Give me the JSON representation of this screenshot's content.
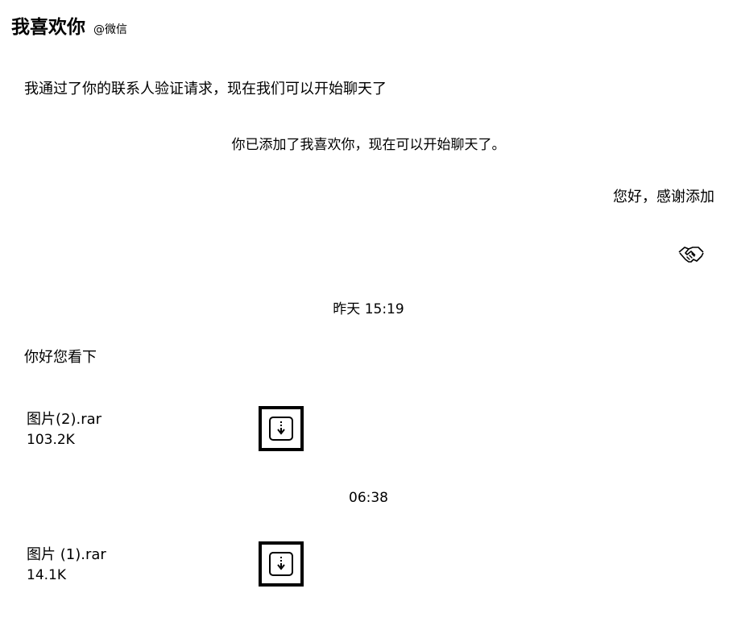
{
  "header": {
    "contact_name": "我喜欢你",
    "platform": "@微信"
  },
  "messages": {
    "incoming_verify": "我通过了你的联系人验证请求，现在我们可以开始聊天了",
    "system_added": "你已添加了我喜欢你，现在可以开始聊天了。",
    "outgoing_thanks": "您好，感谢添加",
    "outgoing_emoji": "handshake-icon",
    "timestamp_1": "昨天 15:19",
    "incoming_look": "你好您看下",
    "timestamp_2": "06:38"
  },
  "files": [
    {
      "name": "图片(2).rar",
      "size": "103.2K",
      "icon": "download-file-icon"
    },
    {
      "name": "图片 (1).rar",
      "size": "14.1K",
      "icon": "download-file-icon"
    }
  ]
}
